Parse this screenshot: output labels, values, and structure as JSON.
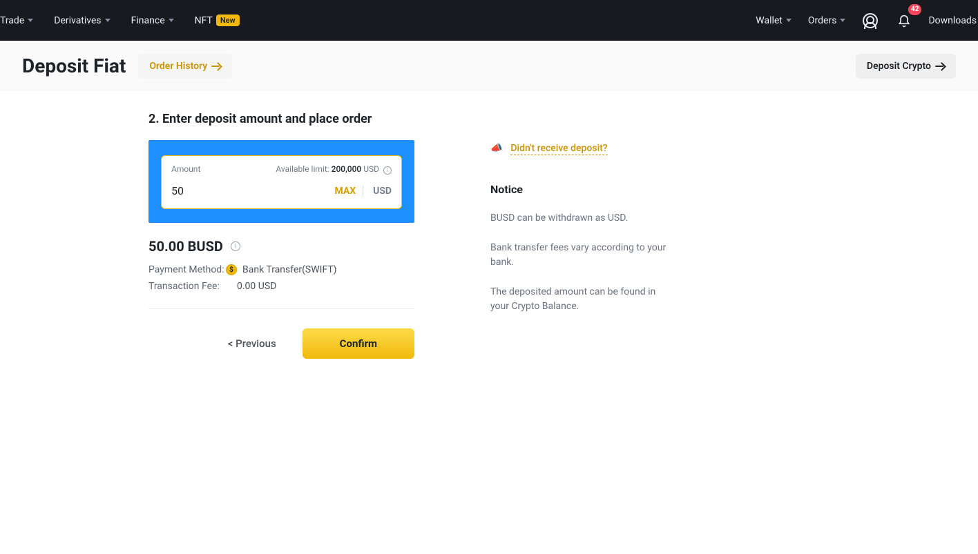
{
  "nav": {
    "left": [
      {
        "label": "Trade",
        "caret": true
      },
      {
        "label": "Derivatives",
        "caret": true
      },
      {
        "label": "Finance",
        "caret": true
      },
      {
        "label": "NFT",
        "caret": false,
        "badge": "New"
      }
    ],
    "right": [
      {
        "label": "Wallet",
        "caret": true
      },
      {
        "label": "Orders",
        "caret": true
      }
    ],
    "notif_count": "42",
    "downloads": "Downloads"
  },
  "subheader": {
    "title": "Deposit Fiat",
    "order_history": "Order History",
    "deposit_crypto": "Deposit Crypto"
  },
  "form": {
    "step_title": "2. Enter deposit amount and place order",
    "amount_label": "Amount",
    "available_prefix": "Available limit:",
    "available_value": "200,000",
    "available_cur": "USD",
    "input_value": "50",
    "max": "MAX",
    "input_cur": "USD",
    "result": "50.00 BUSD",
    "pm_label": "Payment Method:",
    "pm_value": "Bank Transfer(SWIFT)",
    "fee_label": "Transaction Fee:",
    "fee_value": "0.00 USD",
    "prev": "< Previous",
    "confirm": "Confirm"
  },
  "side": {
    "help": "Didn't receive deposit?",
    "notice_title": "Notice",
    "p1": "BUSD can be withdrawn as USD.",
    "p2": "Bank transfer fees vary according to your bank.",
    "p3": "The deposited amount can be found in your Crypto Balance."
  }
}
